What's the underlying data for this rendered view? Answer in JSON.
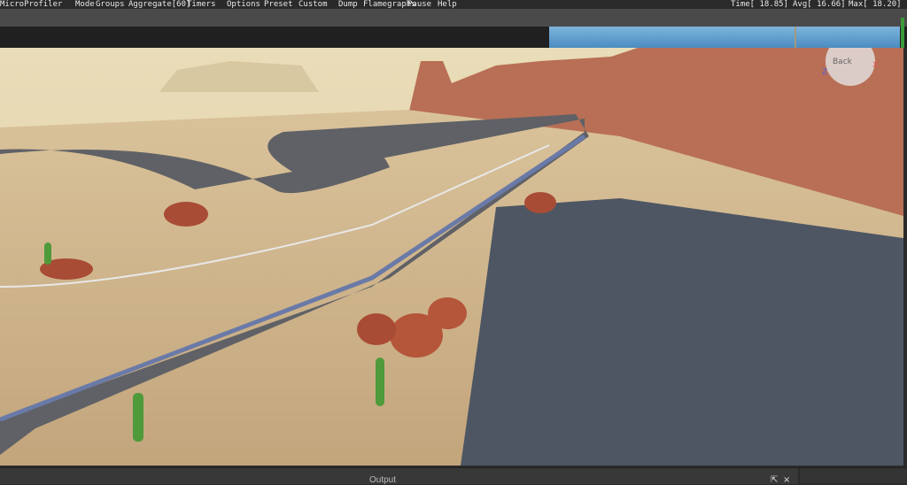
{
  "menu": {
    "title": "MicroProfiler",
    "items": [
      "Mode",
      "Groups",
      "Aggregate[60]",
      "Timers",
      "Options",
      "Preset",
      "Custom",
      "Dump",
      "Flamegraphs",
      "Pause",
      "Help"
    ]
  },
  "stats": {
    "time": "Time[ 18.85]",
    "avg": "Avg[ 16.66]",
    "max": "Max[ 18.20]"
  },
  "gizmo": {
    "label": "Back",
    "x": "X",
    "z": "Z"
  },
  "panel": {
    "title": "Output",
    "undock_icon": "undock-icon",
    "close_icon": "close-icon"
  },
  "colors": {
    "graph_bar": "#6aa6d6",
    "sand": "#c9a87a",
    "road": "#55575c"
  }
}
